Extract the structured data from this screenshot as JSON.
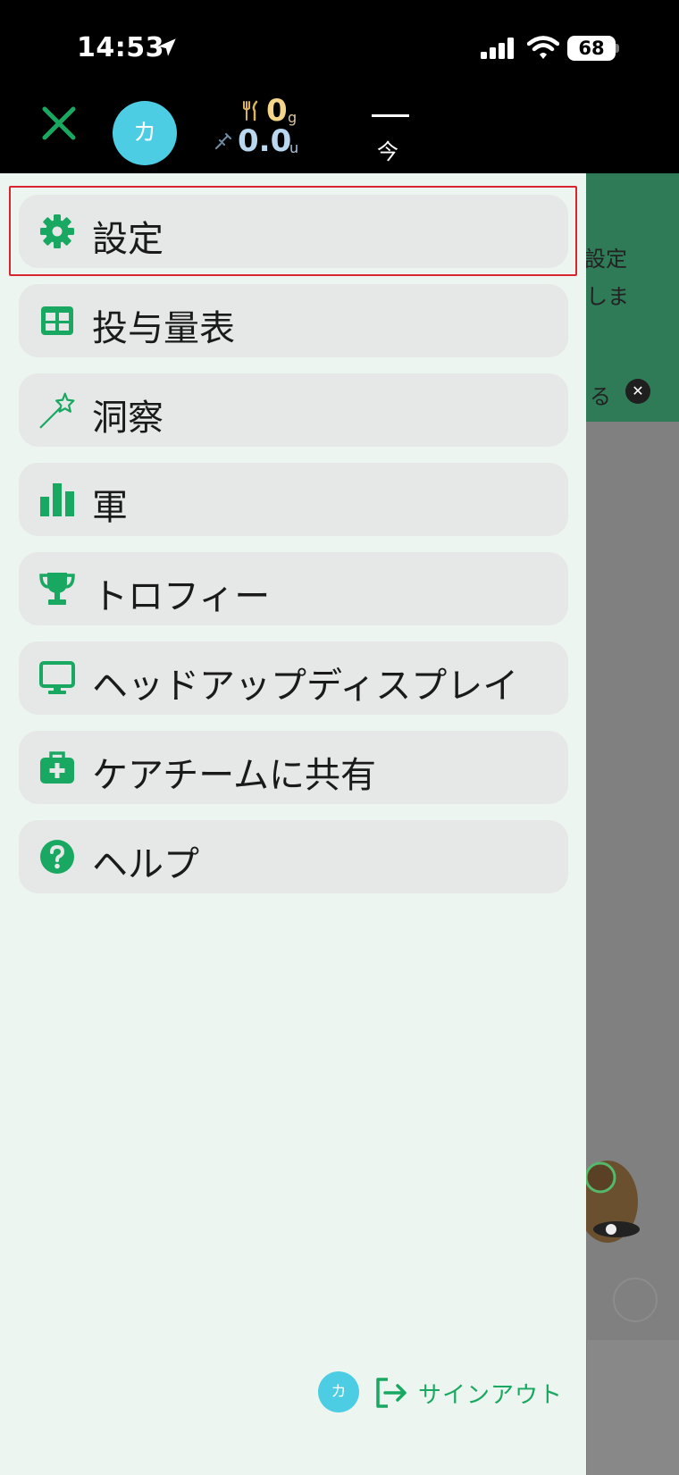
{
  "status_bar": {
    "time": "14:53",
    "battery": "68"
  },
  "header": {
    "avatar_initial": "カ",
    "carbs_value": "0",
    "carbs_unit": "g",
    "insulin_value": "0.0",
    "insulin_unit": "u",
    "time_label": "今"
  },
  "background_peek": {
    "line1": "設定",
    "line2": "しま",
    "line3": "る"
  },
  "menu": {
    "items": [
      {
        "label": "設定",
        "icon": "gear-icon"
      },
      {
        "label": "投与量表",
        "icon": "table-icon"
      },
      {
        "label": "洞察",
        "icon": "magic-wand-icon"
      },
      {
        "label": "軍",
        "icon": "bar-chart-icon"
      },
      {
        "label": "トロフィー",
        "icon": "trophy-icon"
      },
      {
        "label": "ヘッドアップディスプレイ",
        "icon": "monitor-icon"
      },
      {
        "label": "ケアチームに共有",
        "icon": "medical-bag-icon"
      },
      {
        "label": "ヘルプ",
        "icon": "help-icon"
      }
    ]
  },
  "footer": {
    "avatar_initial": "カ",
    "signout_label": "サインアウト"
  },
  "colors": {
    "accent": "#19a862",
    "avatar": "#4ccde3",
    "highlight": "#d9252f"
  }
}
